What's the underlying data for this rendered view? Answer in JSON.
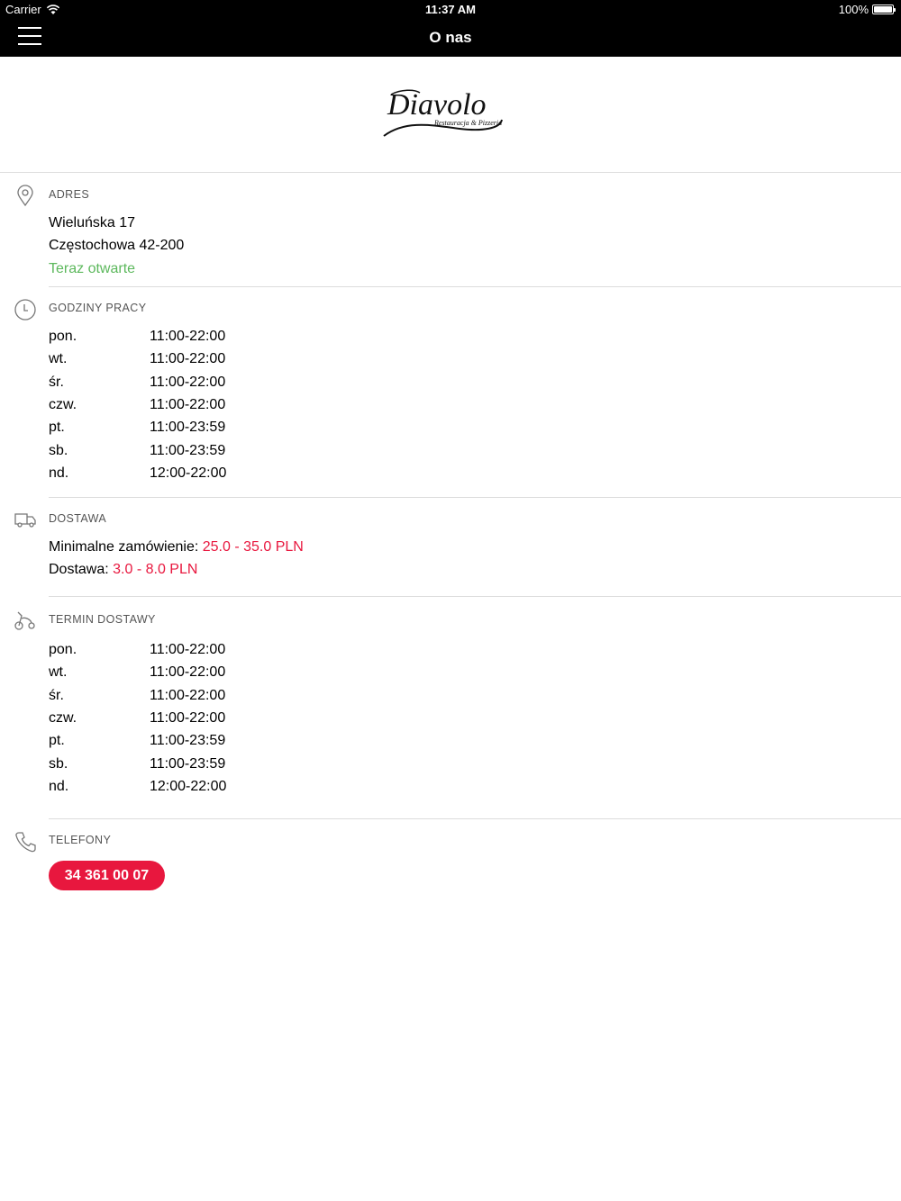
{
  "status_bar": {
    "carrier": "Carrier",
    "time": "11:37 AM",
    "battery": "100%"
  },
  "nav": {
    "title": "O nas"
  },
  "logo": {
    "name": "Diavolo",
    "tagline": "Restauracja & Pizzeria"
  },
  "address": {
    "label": "ADRES",
    "street": "Wieluńska  17",
    "city": "Częstochowa 42-200",
    "status": "Teraz otwarte"
  },
  "opening_hours": {
    "label": "GODZINY PRACY",
    "rows": [
      {
        "day": "pon.",
        "hours": "11:00-22:00"
      },
      {
        "day": "wt.",
        "hours": "11:00-22:00"
      },
      {
        "day": "śr.",
        "hours": "11:00-22:00"
      },
      {
        "day": "czw.",
        "hours": "11:00-22:00"
      },
      {
        "day": "pt.",
        "hours": "11:00-23:59"
      },
      {
        "day": "sb.",
        "hours": "11:00-23:59"
      },
      {
        "day": "nd.",
        "hours": "12:00-22:00"
      }
    ]
  },
  "delivery": {
    "label": "DOSTAWA",
    "min_order_label": "Minimalne zamówienie:",
    "min_order_value": "25.0 - 35.0 PLN",
    "fee_label": "Dostawa:",
    "fee_value": "3.0 - 8.0 PLN"
  },
  "delivery_hours": {
    "label": "TERMIN DOSTAWY",
    "rows": [
      {
        "day": "pon.",
        "hours": "11:00-22:00"
      },
      {
        "day": "wt.",
        "hours": "11:00-22:00"
      },
      {
        "day": "śr.",
        "hours": "11:00-22:00"
      },
      {
        "day": "czw.",
        "hours": "11:00-22:00"
      },
      {
        "day": "pt.",
        "hours": "11:00-23:59"
      },
      {
        "day": "sb.",
        "hours": "11:00-23:59"
      },
      {
        "day": "nd.",
        "hours": "12:00-22:00"
      }
    ]
  },
  "phones": {
    "label": "TELEFONY",
    "number": "34 361 00 07"
  },
  "colors": {
    "accent_red": "#e8173e",
    "open_green": "#5cb85c",
    "nav_bg": "#000000"
  },
  "icons": [
    "menu-icon",
    "wifi-icon",
    "battery-icon",
    "location-pin-icon",
    "clock-icon",
    "delivery-truck-icon",
    "scooter-icon",
    "phone-icon"
  ]
}
